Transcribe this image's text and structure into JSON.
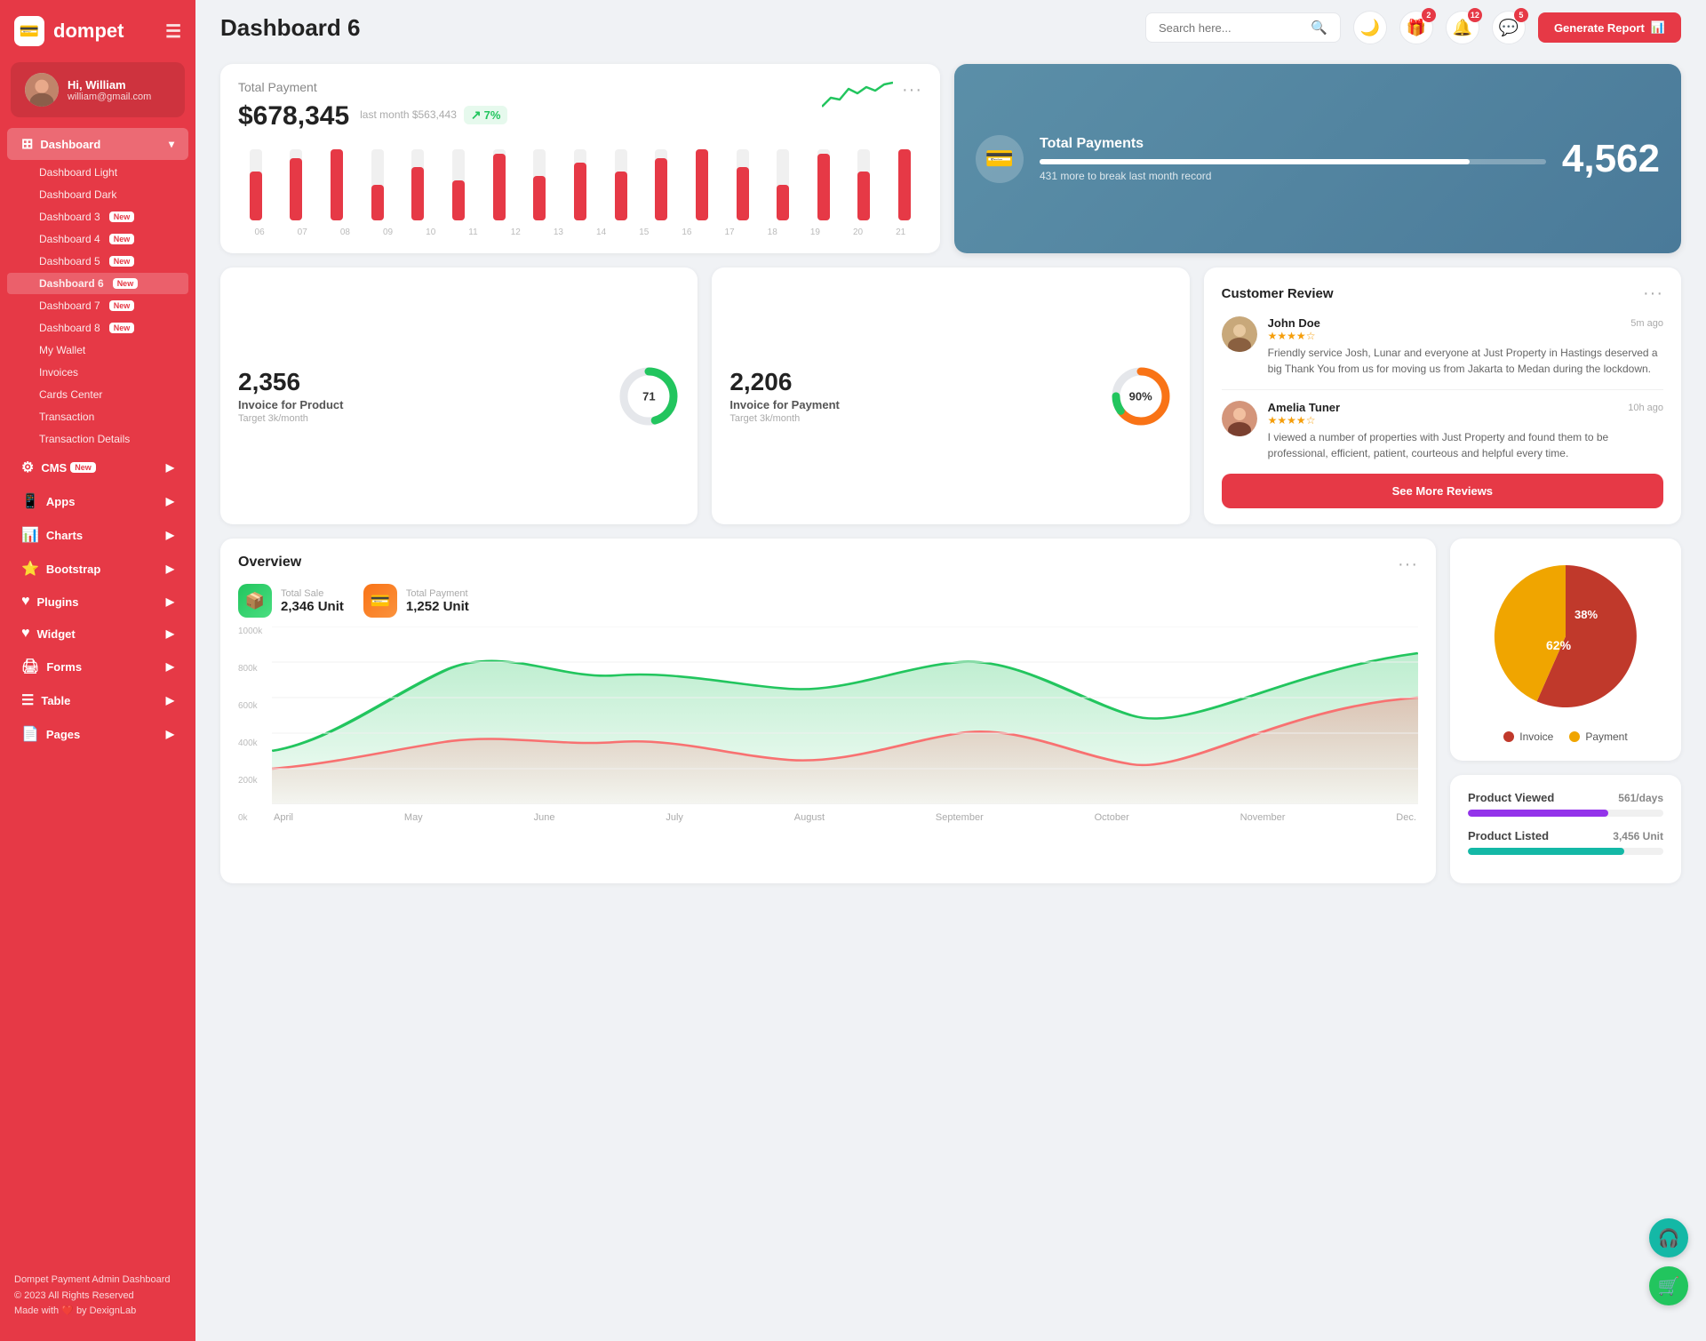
{
  "app": {
    "name": "dompet",
    "logo_icon": "💳"
  },
  "user": {
    "greeting": "Hi, William",
    "name": "William",
    "email": "william@gmail.com"
  },
  "header": {
    "title": "Dashboard 6",
    "search_placeholder": "Search here...",
    "generate_btn": "Generate Report",
    "badges": {
      "gift": "2",
      "bell": "12",
      "chat": "5"
    }
  },
  "sidebar": {
    "dashboard_label": "Dashboard",
    "items": [
      {
        "label": "Dashboard Light",
        "new": false,
        "active": false
      },
      {
        "label": "Dashboard Dark",
        "new": false,
        "active": false
      },
      {
        "label": "Dashboard 3",
        "new": true,
        "active": false
      },
      {
        "label": "Dashboard 4",
        "new": true,
        "active": false
      },
      {
        "label": "Dashboard 5",
        "new": true,
        "active": false
      },
      {
        "label": "Dashboard 6",
        "new": true,
        "active": true
      },
      {
        "label": "Dashboard 7",
        "new": true,
        "active": false
      },
      {
        "label": "Dashboard 8",
        "new": true,
        "active": false
      },
      {
        "label": "My Wallet",
        "new": false,
        "active": false
      },
      {
        "label": "Invoices",
        "new": false,
        "active": false
      },
      {
        "label": "Cards Center",
        "new": false,
        "active": false
      },
      {
        "label": "Transaction",
        "new": false,
        "active": false
      },
      {
        "label": "Transaction Details",
        "new": false,
        "active": false
      }
    ],
    "nav_sections": [
      {
        "label": "CMS",
        "new": true,
        "icon": "⚙️"
      },
      {
        "label": "Apps",
        "new": false,
        "icon": "📱"
      },
      {
        "label": "Charts",
        "new": false,
        "icon": "📊"
      },
      {
        "label": "Bootstrap",
        "new": false,
        "icon": "⭐"
      },
      {
        "label": "Plugins",
        "new": false,
        "icon": "❤️"
      },
      {
        "label": "Widget",
        "new": false,
        "icon": "❤️"
      },
      {
        "label": "Forms",
        "new": false,
        "icon": "🖨️"
      },
      {
        "label": "Table",
        "new": false,
        "icon": "☰"
      },
      {
        "label": "Pages",
        "new": false,
        "icon": "📄"
      }
    ],
    "footer_brand": "Dompet Payment Admin Dashboard",
    "footer_copy": "© 2023 All Rights Reserved",
    "footer_made": "Made with ❤️ by DexignLab"
  },
  "total_payment": {
    "title": "Total Payment",
    "amount": "$678,345",
    "last_month_label": "last month $563,443",
    "trend": "7%",
    "dots": "···",
    "bars": [
      55,
      70,
      80,
      40,
      60,
      45,
      75,
      50,
      65,
      55,
      70,
      80,
      60,
      40,
      75,
      55,
      80
    ]
  },
  "total_payments_blue": {
    "title": "Total Payments",
    "count": "4,562",
    "sub": "431 more to break last month record",
    "progress": 85
  },
  "invoice_product": {
    "number": "2,356",
    "label": "Invoice for Product",
    "target": "Target 3k/month",
    "percent": 71,
    "color": "#22c55e"
  },
  "invoice_payment": {
    "number": "2,206",
    "label": "Invoice for Payment",
    "target": "Target 3k/month",
    "percent": 90,
    "color": "#f97316"
  },
  "overview": {
    "title": "Overview",
    "dots": "···",
    "total_sale_label": "Total Sale",
    "total_sale_value": "2,346 Unit",
    "total_payment_label": "Total Payment",
    "total_payment_value": "1,252 Unit",
    "x_labels": [
      "April",
      "May",
      "June",
      "July",
      "August",
      "September",
      "October",
      "November",
      "Dec."
    ],
    "y_labels": [
      "1000k",
      "800k",
      "600k",
      "400k",
      "200k",
      "0k"
    ]
  },
  "pie_chart": {
    "invoice_pct": "62%",
    "payment_pct": "38%",
    "invoice_color": "#c0392b",
    "payment_color": "#f0a500",
    "legend_invoice": "Invoice",
    "legend_payment": "Payment"
  },
  "product_stats": {
    "viewed_label": "Product Viewed",
    "viewed_count": "561/days",
    "viewed_pct": 72,
    "listed_label": "Product Listed",
    "listed_count": "3,456 Unit",
    "listed_pct": 80
  },
  "customer_review": {
    "title": "Customer Review",
    "dots": "···",
    "reviews": [
      {
        "name": "John Doe",
        "time": "5m ago",
        "stars": 4,
        "text": "Friendly service Josh, Lunar and everyone at Just Property in Hastings deserved a big Thank You from us for moving us from Jakarta to Medan during the lockdown."
      },
      {
        "name": "Amelia Tuner",
        "time": "10h ago",
        "stars": 4,
        "text": "I viewed a number of properties with Just Property and found them to be professional, efficient, patient, courteous and helpful every time."
      }
    ],
    "see_more_btn": "See More Reviews"
  },
  "floating": {
    "headset_icon": "🎧",
    "cart_icon": "🛒"
  }
}
